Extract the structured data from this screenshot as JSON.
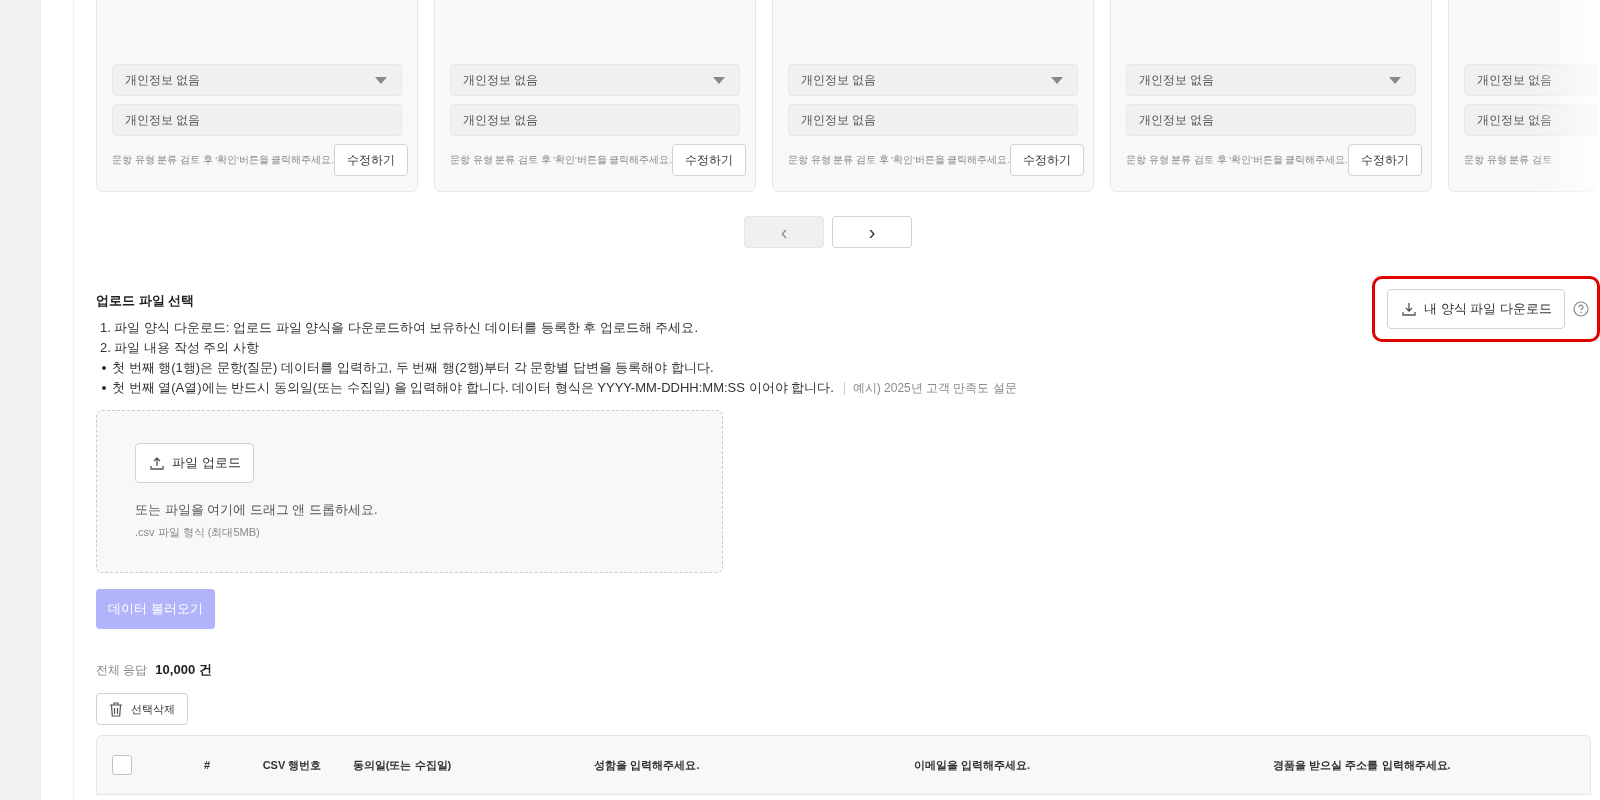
{
  "cards": [
    {
      "kind": "full",
      "select": "개인정보 없음",
      "field": "개인정보 없음",
      "hint": "문항 유형 분류 검토 후 '확인'버튼을 클릭해주세요.",
      "button": "수정하기"
    },
    {
      "kind": "full",
      "select": "개인정보 없음",
      "field": "개인정보 없음",
      "hint": "문항 유형 분류 검토 후 '확인'버튼을 클릭해주세요.",
      "button": "수정하기"
    },
    {
      "kind": "full",
      "select": "개인정보 없음",
      "field": "개인정보 없음",
      "hint": "문항 유형 분류 검토 후 '확인'버튼을 클릭해주세요.",
      "button": "수정하기"
    },
    {
      "kind": "full",
      "select": "개인정보 없음",
      "field": "개인정보 없음",
      "hint": "문항 유형 분류 검토 후 '확인'버튼을 클릭해주세요.",
      "button": "수정하기"
    },
    {
      "kind": "partial",
      "select": "개인정보 없음",
      "field": "개인정보 없음",
      "hint": "문항 유형 분류 검토"
    }
  ],
  "pagination": {
    "prev": {
      "label": "‹",
      "disabled": true
    },
    "next": {
      "label": "›",
      "disabled": false
    }
  },
  "upload": {
    "title": "업로드 파일 선택",
    "steps": [
      "1. 파일 양식 다운로드: 업로드 파일 양식을 다운로드하여 보유하신 데이터를 등록한 후 업로드해 주세요.",
      "2. 파일 내용 작성 주의 사항"
    ],
    "notes": [
      {
        "text": "첫 번째 행(1행)은 문항(질문) 데이터를 입력하고, 두 번째 행(2행)부터 각 문항별 답변을 등록해야 합니다."
      },
      {
        "text": "첫 번째 열(A열)에는 반드시 동의일(또는 수집일) 을 입력해야 합니다. 데이터 형식은 YYYY-MM-DDHH:MM:SS 이어야 합니다.",
        "example": "예시) 2025년 고객 만족도 설문"
      }
    ],
    "download_button": "내 양식 파일 다운로드",
    "download_highlighted": true,
    "upload_button": "파일 업로드",
    "drop_text": "또는 파일을 여기에 드래그 앤 드롭하세요.",
    "format_text": ".csv 파일 형식 (최대5MB)",
    "load_button": {
      "label": "데이터 불러오기",
      "disabled": true
    }
  },
  "summary": {
    "label": "전체 응답",
    "count": "10,000 건"
  },
  "delete_button": "선택삭제",
  "table": {
    "select_all_checked": false,
    "columns": [
      "#",
      "CSV 행번호",
      "동의일(또는 수집일)",
      "성함을 입력해주세요.",
      "이메일을 입력해주세요.",
      "경품을 받으실 주소를 입력해주세요."
    ]
  }
}
